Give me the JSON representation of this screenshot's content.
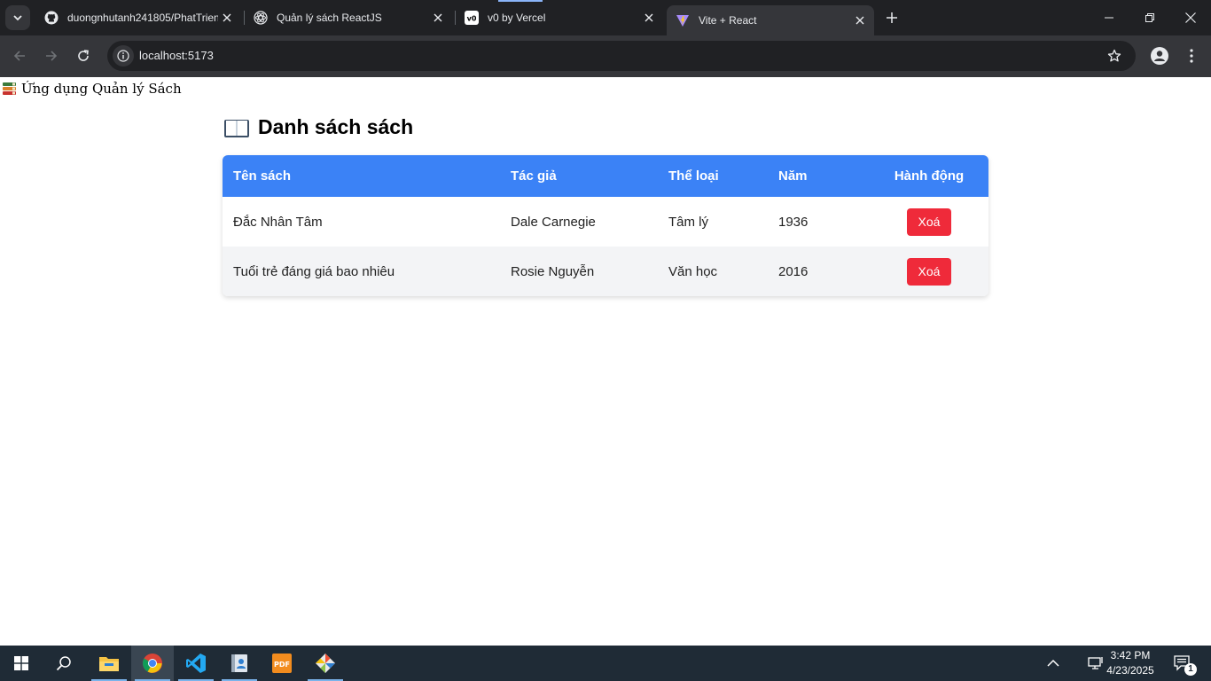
{
  "browser": {
    "tabs": [
      {
        "title": "duongnhutanh241805/PhatTrien",
        "icon": "github-icon"
      },
      {
        "title": "Quản lý sách ReactJS",
        "icon": "react-icon"
      },
      {
        "title": "v0 by Vercel",
        "icon": "v0-icon"
      },
      {
        "title": "Vite + React",
        "icon": "vite-icon",
        "active": true
      }
    ],
    "url": "localhost:5173"
  },
  "app": {
    "header": "Ứng dụng Quản lý Sách",
    "list_title": "Danh sách sách",
    "table": {
      "columns": [
        "Tên sách",
        "Tác giả",
        "Thể loại",
        "Năm",
        "Hành động"
      ],
      "rows": [
        {
          "title": "Đắc Nhân Tâm",
          "author": "Dale Carnegie",
          "genre": "Tâm lý",
          "year": "1936",
          "action": "Xoá"
        },
        {
          "title": "Tuổi trẻ đáng giá bao nhiêu",
          "author": "Rosie Nguyễn",
          "genre": "Văn học",
          "year": "2016",
          "action": "Xoá"
        }
      ]
    }
  },
  "taskbar": {
    "time": "3:42 PM",
    "date": "4/23/2025",
    "notification_count": "1"
  },
  "colors": {
    "table_header": "#3b82f6",
    "delete_button": "#ef2a3a",
    "row_alt": "#f3f4f6"
  }
}
